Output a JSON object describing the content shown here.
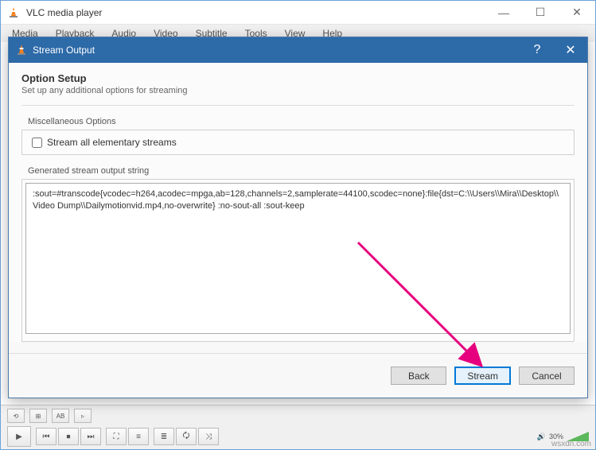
{
  "main": {
    "title": "VLC media player",
    "menus": [
      "Media",
      "Playback",
      "Audio",
      "Video",
      "Subtitle",
      "Tools",
      "View",
      "Help"
    ]
  },
  "dialog": {
    "title": "Stream Output",
    "heading": "Option Setup",
    "subheading": "Set up any additional options for streaming",
    "miscLabel": "Miscellaneous Options",
    "streamAllLabel": "Stream all elementary streams",
    "generatedLabel": "Generated stream output string",
    "outputString": ":sout=#transcode{vcodec=h264,acodec=mpga,ab=128,channels=2,samplerate=44100,scodec=none}:file{dst=C:\\\\Users\\\\Mira\\\\Desktop\\\\Video Dump\\\\Dailymotionvid.mp4,no-overwrite} :no-sout-all :sout-keep",
    "buttons": {
      "back": "Back",
      "stream": "Stream",
      "cancel": "Cancel"
    }
  },
  "player": {
    "volume": "30%"
  },
  "watermark": "wsxdn.com"
}
